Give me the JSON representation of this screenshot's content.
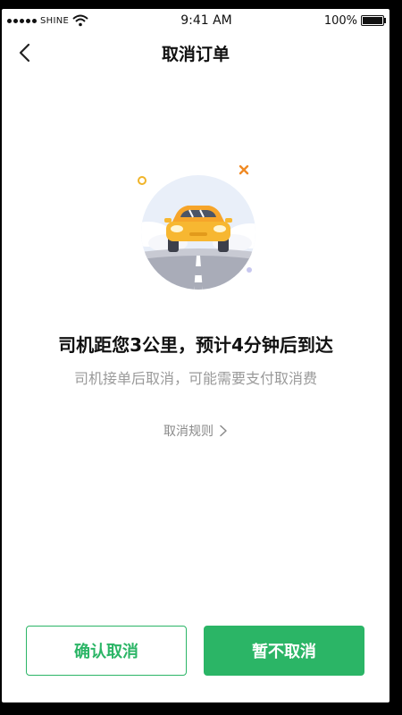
{
  "status_bar": {
    "carrier": "SHINE",
    "time": "9:41 AM",
    "battery": "100%",
    "battery_level": 1.0
  },
  "nav": {
    "title": "取消订单",
    "back_icon": "chevron-left-icon"
  },
  "message": {
    "headline": "司机距您3公里，预计4分钟后到达",
    "subtext": "司机接单后取消，可能需要支付取消费"
  },
  "rules_link": {
    "label": "取消规则",
    "icon": "chevron-right-icon"
  },
  "buttons": {
    "confirm": "确认取消",
    "keep": "暂不取消"
  },
  "colors": {
    "primary_green": "#2bb566",
    "car_yellow": "#f7b731"
  }
}
